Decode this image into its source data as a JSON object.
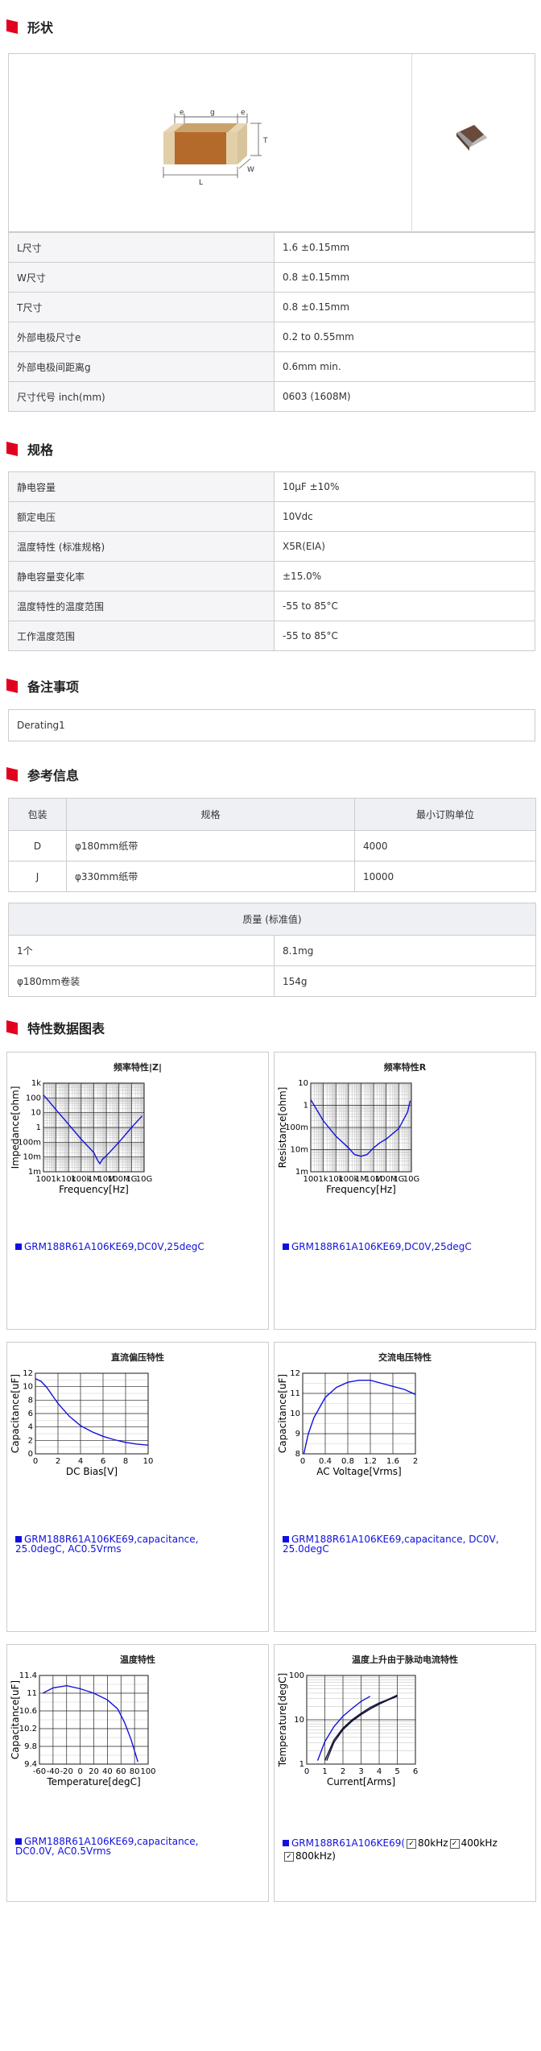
{
  "colors": {
    "accent": "#e1001e",
    "curve": "#1111dd"
  },
  "shape": {
    "title": "形状",
    "dim_labels": {
      "e1": "e",
      "g": "g",
      "e2": "e",
      "T": "T",
      "L": "L",
      "W": "W"
    },
    "rows": [
      {
        "k": "L尺寸",
        "v": "1.6 ±0.15mm"
      },
      {
        "k": "W尺寸",
        "v": "0.8 ±0.15mm"
      },
      {
        "k": "T尺寸",
        "v": "0.8 ±0.15mm"
      },
      {
        "k": "外部电极尺寸e",
        "v": "0.2 to 0.55mm"
      },
      {
        "k": "外部电极间距离g",
        "v": "0.6mm min."
      },
      {
        "k": "尺寸代号 inch(mm)",
        "v": "0603 (1608M)"
      }
    ]
  },
  "spec": {
    "title": "规格",
    "rows": [
      {
        "k": "静电容量",
        "v": "10μF ±10%"
      },
      {
        "k": "额定电压",
        "v": "10Vdc"
      },
      {
        "k": "温度特性 (标准规格)",
        "v": "X5R(EIA)"
      },
      {
        "k": "静电容量变化率",
        "v": "±15.0%"
      },
      {
        "k": "温度特性的温度范围",
        "v": "-55 to 85°C"
      },
      {
        "k": "工作温度范围",
        "v": "-55 to 85°C"
      }
    ]
  },
  "remarks": {
    "title": "备注事项",
    "text": "Derating1"
  },
  "reference": {
    "title": "参考信息",
    "packaging": {
      "headers": [
        "包装",
        "规格",
        "最小订购单位"
      ],
      "rows": [
        {
          "code": "D",
          "spec": "φ180mm纸带",
          "moq": "4000"
        },
        {
          "code": "J",
          "spec": "φ330mm纸带",
          "moq": "10000"
        }
      ]
    },
    "mass": {
      "header": "质量 (标准值)",
      "rows": [
        {
          "k": "1个",
          "v": "8.1mg"
        },
        {
          "k": "φ180mm卷装",
          "v": "154g"
        }
      ]
    }
  },
  "charts_section": {
    "title": "特性数据图表"
  },
  "chart_data": [
    {
      "type": "line",
      "title": "频率特性|Z|",
      "xlabel": "Frequency[Hz]",
      "ylabel": "Impedance[ohm]",
      "xscale": "log",
      "yscale": "log",
      "xlim": [
        100,
        10000000000
      ],
      "ylim": [
        0.001,
        1000
      ],
      "xticks": [
        "100",
        "1k",
        "10k",
        "100k",
        "1M",
        "10M",
        "100M",
        "1G",
        "10G"
      ],
      "yticks": [
        "1m",
        "10m",
        "100m",
        "1",
        "10",
        "100",
        "1k"
      ],
      "series": [
        {
          "name": "GRM188R61A106KE69,DC0V,25degC",
          "x": [
            100,
            1000,
            10000,
            100000,
            1000000,
            2000000,
            3000000,
            5000000,
            10000000,
            100000000,
            1000000000,
            7000000000
          ],
          "y": [
            160,
            16,
            1.6,
            0.16,
            0.02,
            0.006,
            0.0035,
            0.007,
            0.012,
            0.1,
            1,
            6
          ]
        }
      ],
      "grid": true
    },
    {
      "type": "line",
      "title": "频率特性R",
      "xlabel": "Frequency[Hz]",
      "ylabel": "Resistance[ohm]",
      "xscale": "log",
      "yscale": "log",
      "xlim": [
        100,
        10000000000
      ],
      "ylim": [
        0.001,
        10
      ],
      "xticks": [
        "100",
        "1k",
        "10k",
        "100k",
        "1M",
        "10M",
        "100M",
        "1G",
        "10G"
      ],
      "yticks": [
        "1m",
        "10m",
        "100m",
        "1",
        "10"
      ],
      "series": [
        {
          "name": "GRM188R61A106KE69,DC0V,25degC",
          "x": [
            100,
            1000,
            10000,
            100000,
            300000,
            1000000,
            3000000,
            10000000,
            30000000,
            100000000,
            1000000000,
            5000000000,
            8000000000
          ],
          "y": [
            1.8,
            0.2,
            0.04,
            0.012,
            0.006,
            0.005,
            0.006,
            0.012,
            0.02,
            0.03,
            0.09,
            0.5,
            1.6
          ]
        }
      ],
      "grid": true
    },
    {
      "type": "line",
      "title": "直流偏压特性",
      "xlabel": "DC Bias[V]",
      "ylabel": "Capacitance[uF]",
      "xlim": [
        0,
        10
      ],
      "ylim": [
        0,
        12
      ],
      "xticks": [
        "0",
        "2",
        "4",
        "6",
        "8",
        "10"
      ],
      "yticks": [
        "0",
        "2",
        "4",
        "6",
        "8",
        "10",
        "12"
      ],
      "series": [
        {
          "name": "GRM188R61A106KE69,capacitance, 25.0degC, AC0.5Vrms",
          "x": [
            0,
            0.5,
            1,
            2,
            3,
            4,
            5,
            6,
            7,
            8,
            9,
            10
          ],
          "y": [
            11.2,
            10.8,
            9.9,
            7.5,
            5.6,
            4.2,
            3.3,
            2.6,
            2.1,
            1.7,
            1.45,
            1.3
          ]
        }
      ],
      "grid": true
    },
    {
      "type": "line",
      "title": "交流电压特性",
      "xlabel": "AC Voltage[Vrms]",
      "ylabel": "Capacitance[uF]",
      "xlim": [
        0,
        2
      ],
      "ylim": [
        8,
        12
      ],
      "xticks": [
        "0",
        "0.4",
        "0.8",
        "1.2",
        "1.6",
        "2"
      ],
      "yticks": [
        "8",
        "9",
        "10",
        "11",
        "12"
      ],
      "series": [
        {
          "name": "GRM188R61A106KE69,capacitance, DC0V, 25.0degC",
          "x": [
            0.02,
            0.1,
            0.2,
            0.4,
            0.6,
            0.8,
            1.0,
            1.2,
            1.4,
            1.6,
            1.8,
            2.0
          ],
          "y": [
            8.0,
            9.0,
            9.8,
            10.8,
            11.3,
            11.55,
            11.65,
            11.65,
            11.5,
            11.35,
            11.2,
            10.95
          ]
        }
      ],
      "grid": true
    },
    {
      "type": "line",
      "title": "温度特性",
      "xlabel": "Temperature[degC]",
      "ylabel": "Capacitance[uF]",
      "xlim": [
        -60,
        100
      ],
      "ylim": [
        9.4,
        11.4
      ],
      "xticks": [
        "-60",
        "-40",
        "-20",
        "0",
        "20",
        "40",
        "60",
        "80",
        "100"
      ],
      "yticks": [
        "9.4",
        "9.8",
        "10.2",
        "10.6",
        "11",
        "11.4"
      ],
      "series": [
        {
          "name": "GRM188R61A106KE69,capacitance, DC0.0V, AC0.5Vrms",
          "x": [
            -55,
            -40,
            -20,
            0,
            20,
            40,
            55,
            65,
            75,
            85
          ],
          "y": [
            11.0,
            11.12,
            11.17,
            11.1,
            11.0,
            10.85,
            10.65,
            10.35,
            9.95,
            9.45
          ]
        }
      ],
      "grid": true
    },
    {
      "type": "line",
      "title": "温度上升由于脉动电流特性",
      "xlabel": "Current[Arms]",
      "ylabel": "Temperature[degC]",
      "xlim": [
        0,
        6
      ],
      "ylim": [
        1,
        100
      ],
      "yscale": "log",
      "xticks": [
        "0",
        "1",
        "2",
        "3",
        "4",
        "5",
        "6"
      ],
      "yticks": [
        "1",
        "10",
        "100"
      ],
      "legend_prefix": "GRM188R61A106KE69(",
      "series": [
        {
          "name": "80kHz",
          "x": [
            0.6,
            1.0,
            1.5,
            2.0,
            2.5,
            3.0,
            3.5
          ],
          "y": [
            1.2,
            3.2,
            7,
            12,
            18,
            26,
            34
          ]
        },
        {
          "name": "400kHz",
          "x": [
            1.0,
            1.5,
            2.0,
            2.5,
            3.0,
            3.5,
            4.0,
            4.5,
            5.0
          ],
          "y": [
            1.2,
            3.5,
            6.5,
            10,
            14,
            19,
            24,
            29,
            36
          ]
        },
        {
          "name": "800kHz",
          "x": [
            1.1,
            1.5,
            2.0,
            2.5,
            3.0,
            3.5,
            4.0,
            4.5,
            5.0
          ],
          "y": [
            1.2,
            3.1,
            6,
            9.3,
            13,
            17.5,
            22.5,
            28,
            34
          ]
        }
      ],
      "grid": true
    }
  ]
}
